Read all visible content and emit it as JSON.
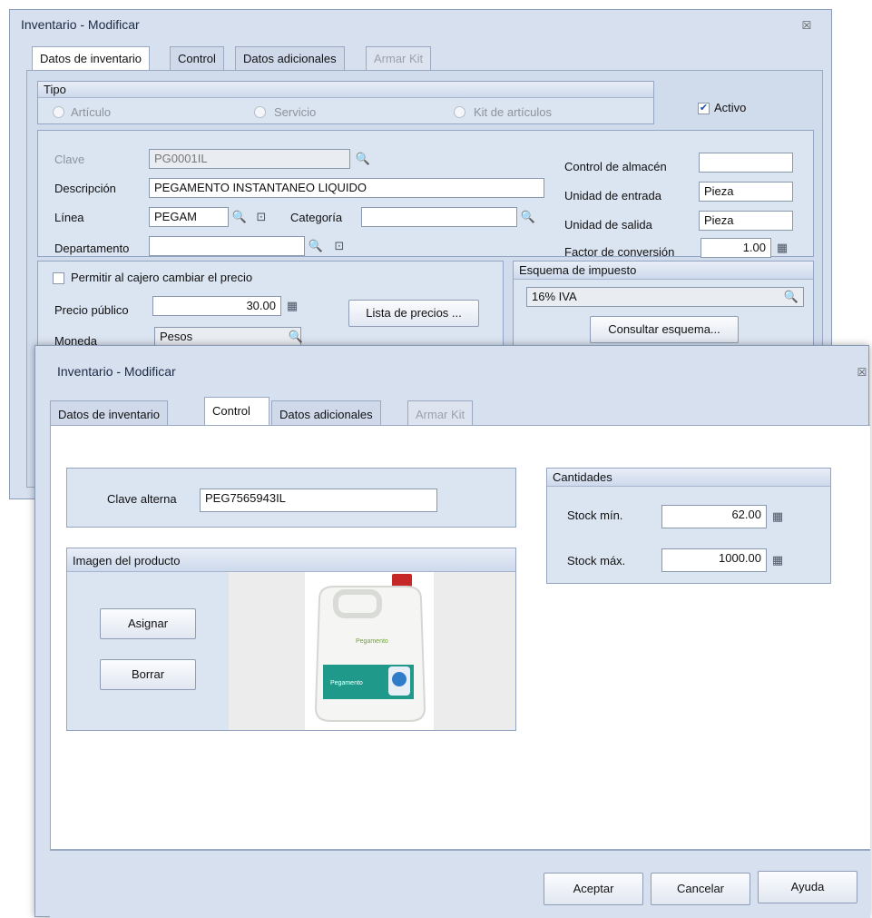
{
  "back": {
    "title": "Inventario - Modificar",
    "close": "☒",
    "tabs": [
      "Datos de inventario",
      "Control",
      "Datos adicionales",
      "Armar Kit"
    ],
    "tipo": {
      "title": "Tipo",
      "options": [
        "Artículo",
        "Servicio",
        "Kit de artículos"
      ],
      "activo": "Activo"
    },
    "fields": {
      "clave_label": "Clave",
      "clave": "PG0001IL",
      "descripcion_label": "Descripción",
      "descripcion": "PEGAMENTO INSTANTANEO LIQUIDO",
      "linea_label": "Línea",
      "linea": "PEGAM",
      "categoria_label": "Categoría",
      "categoria": "",
      "departamento_label": "Departamento",
      "departamento": "",
      "control_almacen_label": "Control de almacén",
      "control_almacen": "",
      "unidad_entrada_label": "Unidad de entrada",
      "unidad_entrada": "Pieza",
      "unidad_salida_label": "Unidad de salida",
      "unidad_salida": "Pieza",
      "factor_label": "Factor de conversión",
      "factor": "1.00"
    },
    "precio": {
      "permitir": "Permitir al cajero cambiar el precio",
      "precio_label": "Precio público",
      "precio": "30.00",
      "lista_button": "Lista de precios ...",
      "moneda_label": "Moneda",
      "moneda": "Pesos"
    },
    "impuesto": {
      "title": "Esquema de impuesto",
      "value": "16% IVA",
      "button": "Consultar esquema..."
    }
  },
  "front": {
    "title": "Inventario - Modificar",
    "close": "☒",
    "tabs": [
      "Datos de inventario",
      "Control",
      "Datos adicionales",
      "Armar Kit"
    ],
    "clave_alterna_label": "Clave alterna",
    "clave_alterna": "PEG7565943IL",
    "cantidades": {
      "title": "Cantidades",
      "stock_min_label": "Stock mín.",
      "stock_min": "62.00",
      "stock_max_label": "Stock máx.",
      "stock_max": "1000.00"
    },
    "imagen": {
      "title": "Imagen del producto",
      "asignar": "Asignar",
      "borrar": "Borrar",
      "product_brand": "Pegamento",
      "product_label": "Pegamento"
    },
    "buttons": {
      "aceptar": "Aceptar",
      "cancelar": "Cancelar",
      "ayuda": "Ayuda"
    }
  },
  "icons": {
    "search": "search-icon",
    "new": "new-item-icon",
    "calc": "calculator-icon",
    "close": "close-icon"
  }
}
